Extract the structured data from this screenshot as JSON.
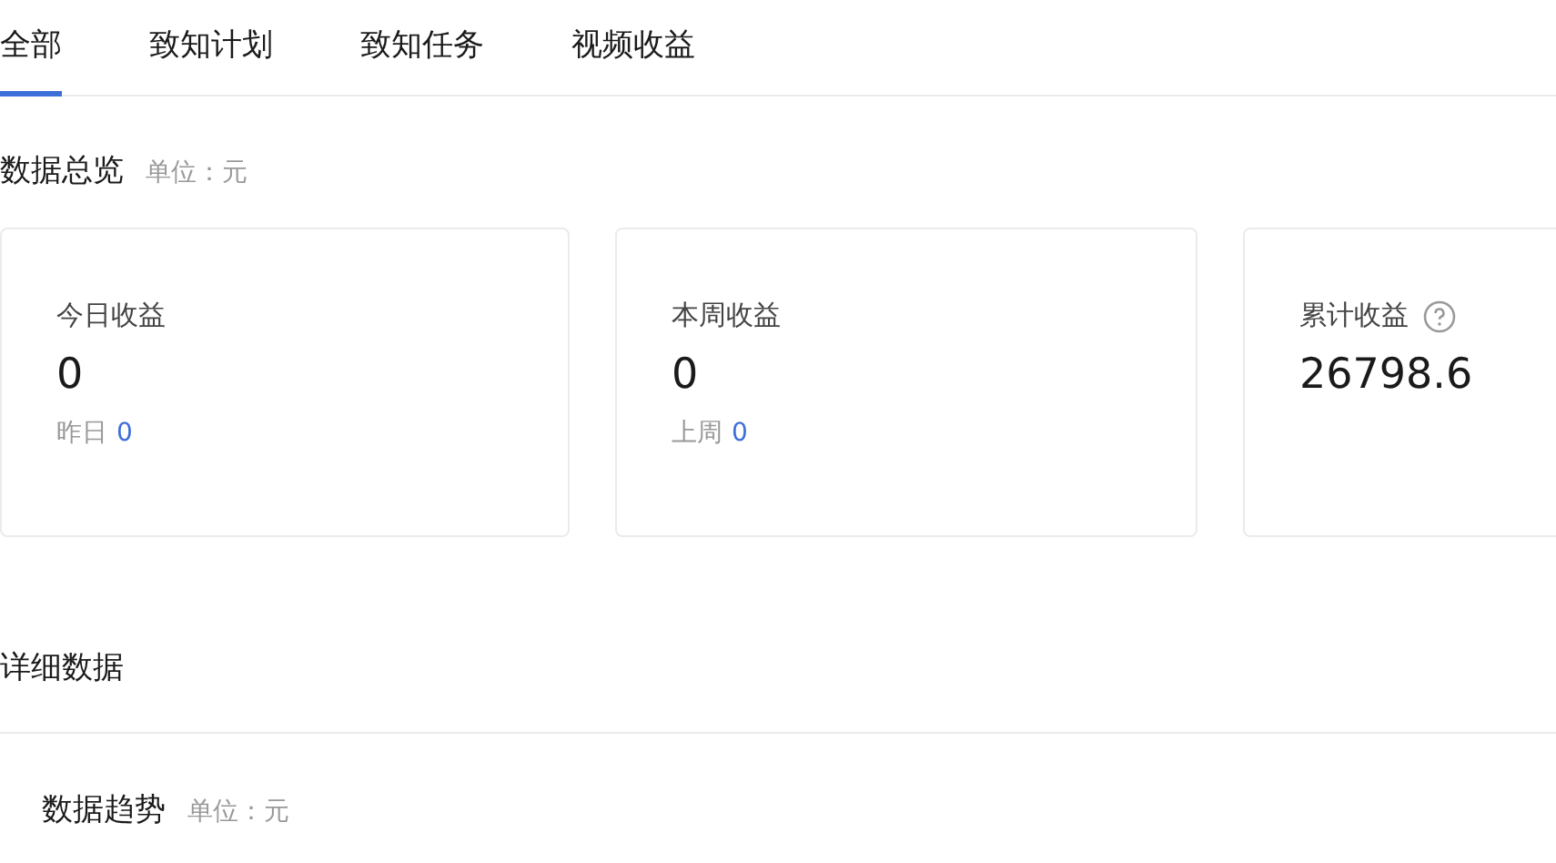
{
  "tabs": [
    {
      "label": "全部",
      "selected": true
    },
    {
      "label": "致知计划",
      "selected": false
    },
    {
      "label": "致知任务",
      "selected": false
    },
    {
      "label": "视频收益",
      "selected": false
    }
  ],
  "overview": {
    "title": "数据总览",
    "unit": "单位：元",
    "cards": [
      {
        "label": "今日收益",
        "value": "0",
        "compare_label": "昨日",
        "compare_value": "0",
        "help": false
      },
      {
        "label": "本周收益",
        "value": "0",
        "compare_label": "上周",
        "compare_value": "0",
        "help": false
      },
      {
        "label": "累计收益",
        "value": "26798.6",
        "help": true
      }
    ]
  },
  "details": {
    "title": "详细数据",
    "trend_title": "数据趋势",
    "trend_unit": "单位：元"
  }
}
